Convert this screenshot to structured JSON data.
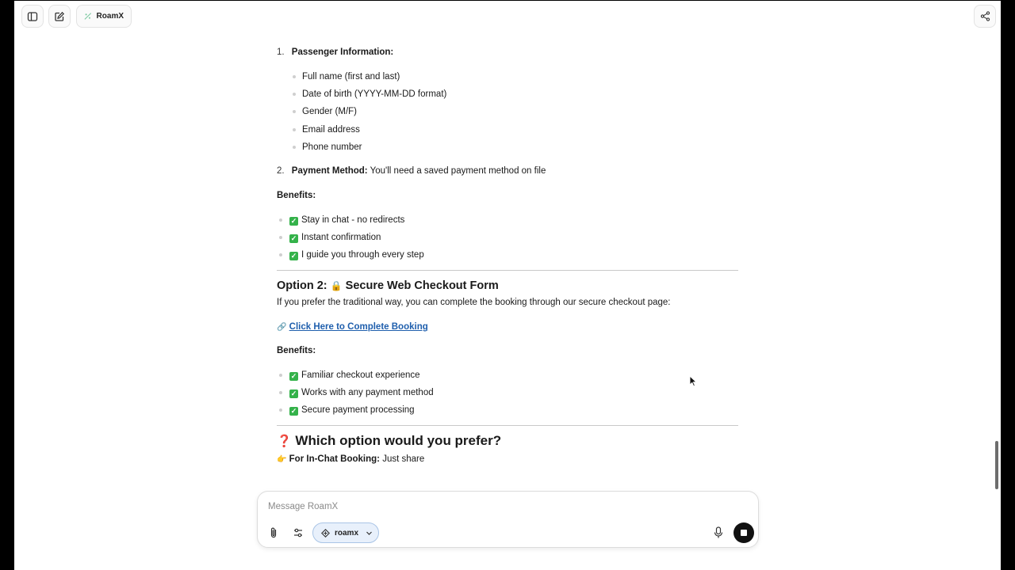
{
  "app": {
    "brand_name": "RoamX"
  },
  "topbar": {
    "sidebar_icon": "sidebar-toggle-icon",
    "new_chat_icon": "new-chat-icon",
    "share_icon": "share-icon"
  },
  "message": {
    "step1": {
      "number": "1.",
      "title": "Passenger Information:"
    },
    "passenger_fields": [
      "Full name (first and last)",
      "Date of birth (YYYY-MM-DD format)",
      "Gender (M/F)",
      "Email address",
      "Phone number"
    ],
    "step2": {
      "number": "2.",
      "title": "Payment Method:",
      "text": "You'll need a saved payment method on file"
    },
    "benefits_label_1": "Benefits:",
    "benefits_1": [
      "Stay in chat - no redirects",
      "Instant confirmation",
      "I guide you through every step"
    ],
    "option2": {
      "prefix": "Option 2: ",
      "icon": "🔒",
      "title": "Secure Web Checkout Form",
      "description": "If you prefer the traditional way, you can complete the booking through our secure checkout page:",
      "link_icon": "🔗",
      "link_text": "Click Here to Complete Booking"
    },
    "benefits_label_2": "Benefits:",
    "benefits_2": [
      "Familiar checkout experience",
      "Works with any payment method",
      "Secure payment processing"
    ],
    "question": {
      "icon": "❓",
      "text": "Which option would you prefer?"
    },
    "followup": {
      "icon": "👉",
      "label": "For In-Chat Booking:",
      "text": "Just share"
    }
  },
  "composer": {
    "placeholder": "Message RoamX",
    "model_label": "roamx",
    "attach_icon": "paperclip-icon",
    "tools_icon": "sliders-icon",
    "mic_icon": "microphone-icon",
    "stop_icon": "stop-icon"
  },
  "colors": {
    "link": "#1f5fad",
    "check": "#34b24a",
    "pill_bg": "#e8f0fb"
  }
}
